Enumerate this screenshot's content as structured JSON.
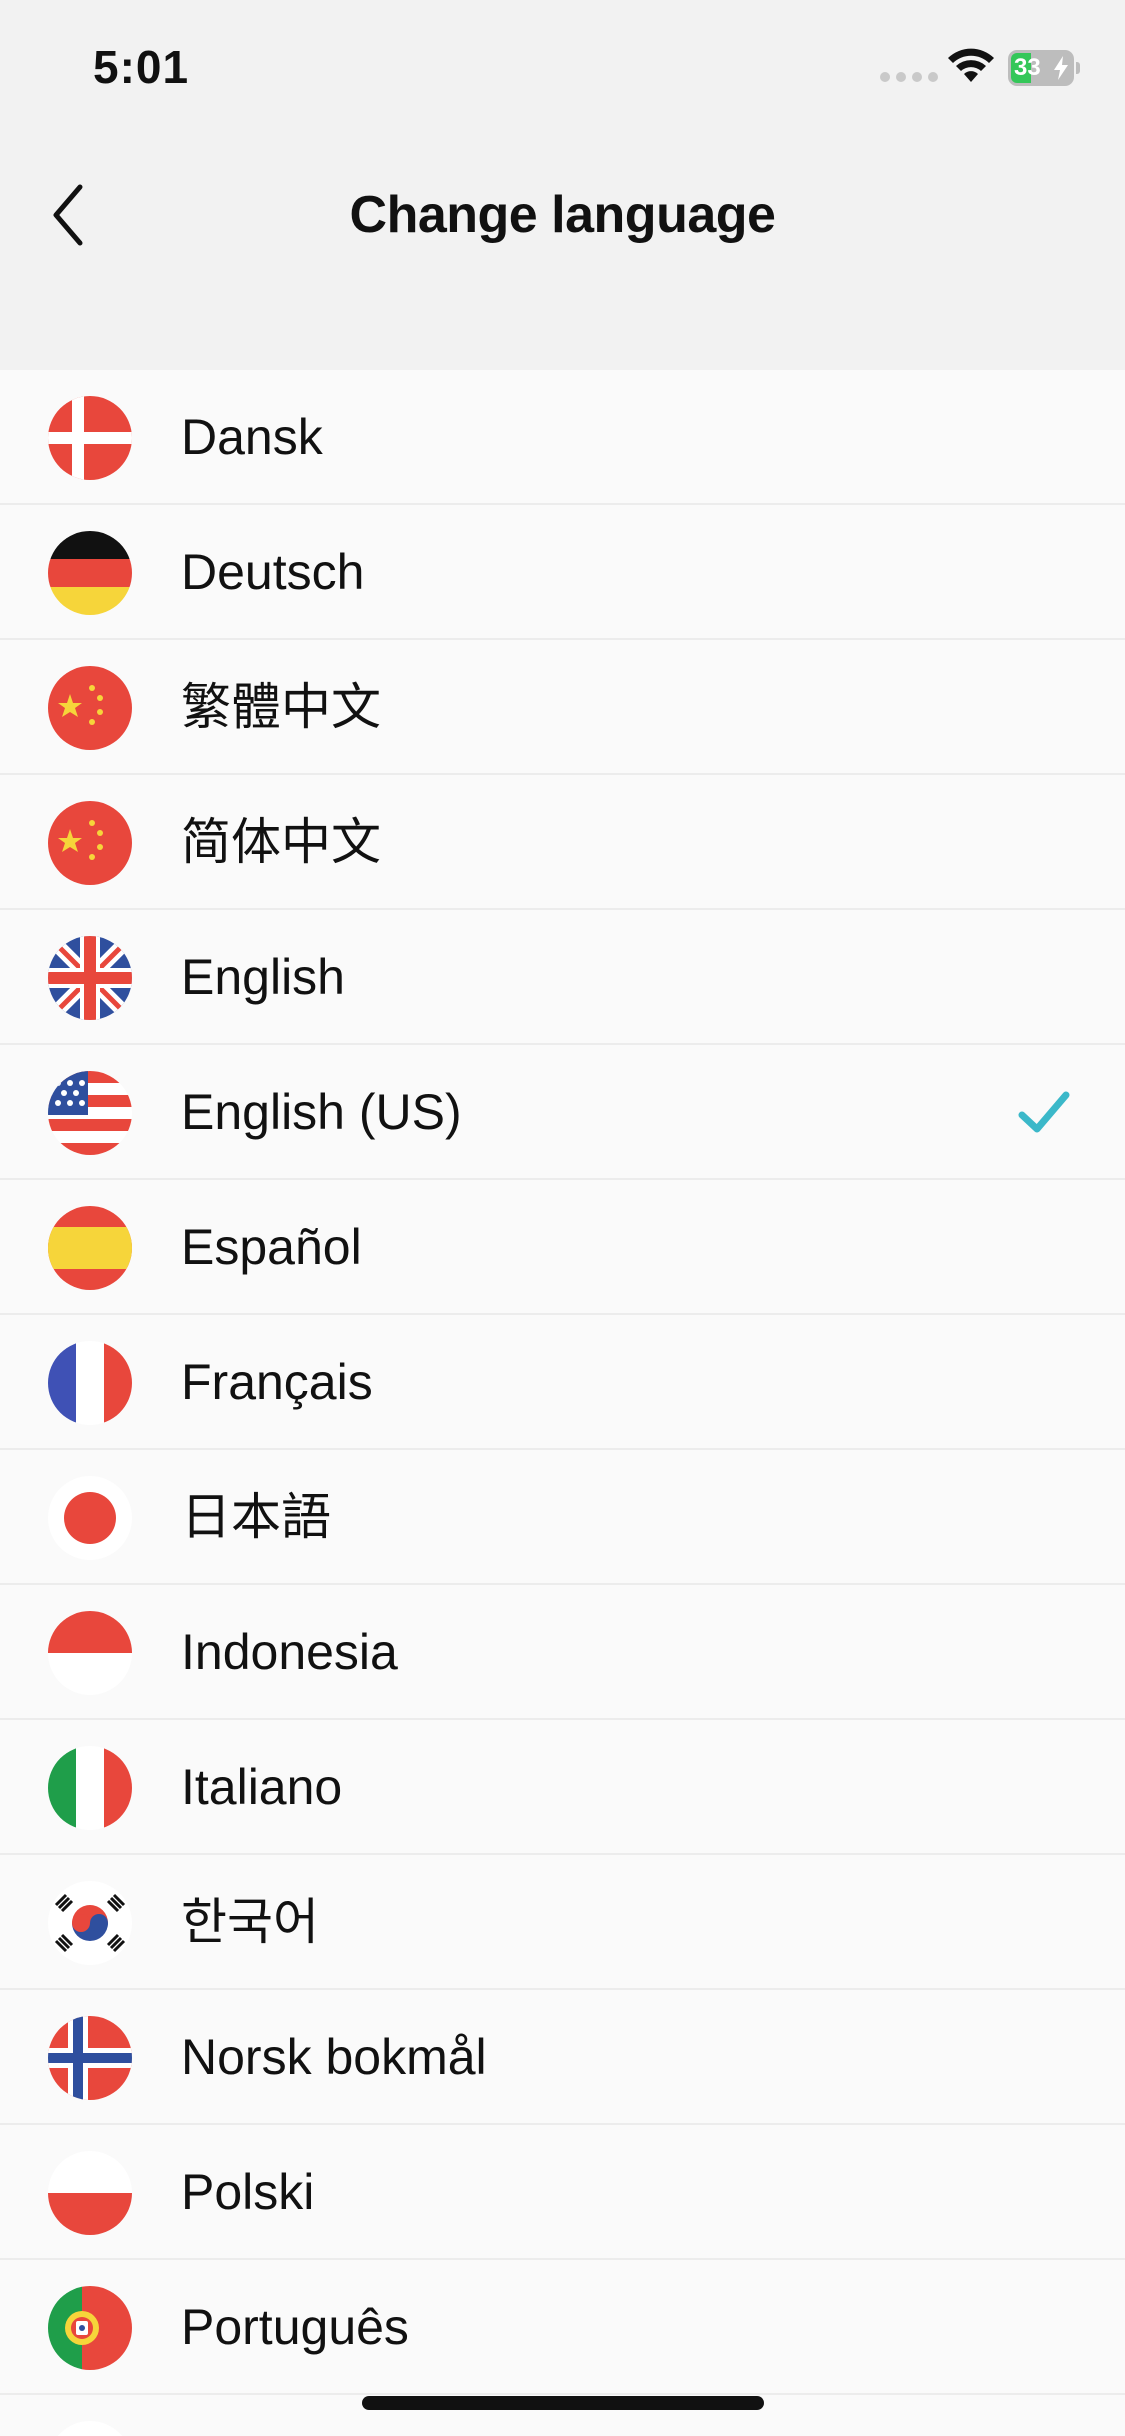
{
  "status_bar": {
    "time": "5:01",
    "battery_level": "33",
    "battery_fraction": 0.33,
    "accent": "#34c759"
  },
  "nav": {
    "back_icon": "chevron-left-icon",
    "title": "Change language"
  },
  "check_color": "#3bb8c9",
  "languages": [
    {
      "label": "Dansk",
      "flag": "denmark-flag-icon",
      "selected": false
    },
    {
      "label": "Deutsch",
      "flag": "germany-flag-icon",
      "selected": false
    },
    {
      "label": "繁體中文",
      "flag": "china-flag-icon",
      "selected": false
    },
    {
      "label": "简体中文",
      "flag": "china-flag-icon",
      "selected": false
    },
    {
      "label": "English",
      "flag": "uk-flag-icon",
      "selected": false
    },
    {
      "label": "English (US)",
      "flag": "us-flag-icon",
      "selected": true
    },
    {
      "label": "Español",
      "flag": "spain-flag-icon",
      "selected": false
    },
    {
      "label": "Français",
      "flag": "france-flag-icon",
      "selected": false
    },
    {
      "label": "日本語",
      "flag": "japan-flag-icon",
      "selected": false
    },
    {
      "label": "Indonesia",
      "flag": "indonesia-flag-icon",
      "selected": false
    },
    {
      "label": "Italiano",
      "flag": "italy-flag-icon",
      "selected": false
    },
    {
      "label": "한국어",
      "flag": "korea-flag-icon",
      "selected": false
    },
    {
      "label": "Norsk bokmål",
      "flag": "norway-flag-icon",
      "selected": false
    },
    {
      "label": "Polski",
      "flag": "poland-flag-icon",
      "selected": false
    },
    {
      "label": "Português",
      "flag": "portugal-flag-icon",
      "selected": false
    }
  ]
}
